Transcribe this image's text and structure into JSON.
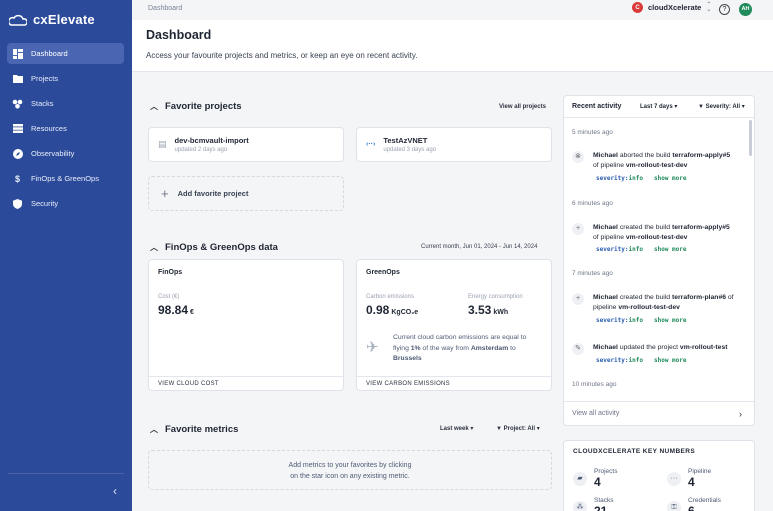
{
  "app": {
    "name": "cxElevate"
  },
  "sidebar": {
    "items": [
      {
        "label": "Dashboard",
        "icon": "dashboard-icon",
        "active": true
      },
      {
        "label": "Projects",
        "icon": "folder-icon"
      },
      {
        "label": "Stacks",
        "icon": "stacks-icon"
      },
      {
        "label": "Resources",
        "icon": "server-icon"
      },
      {
        "label": "Observability",
        "icon": "compass-icon"
      },
      {
        "label": "FinOps & GreenOps",
        "icon": "dollar-icon"
      },
      {
        "label": "Security",
        "icon": "shield-icon"
      }
    ],
    "collapse_icon": "chevron-left-icon"
  },
  "topbar": {
    "breadcrumb": "Dashboard",
    "org_initial": "C",
    "org_name": "cloudXcelerate",
    "avatar": "AH"
  },
  "header": {
    "title": "Dashboard",
    "subtitle": "Access your favourite projects and metrics, or keep an eye on recent activity."
  },
  "favorites": {
    "title": "Favorite projects",
    "view_all": "View all projects",
    "projects": [
      {
        "name": "dev-bcmvault-import",
        "updated": "updated 2 days ago",
        "icon": "page-icon"
      },
      {
        "name": "TestAzVNET",
        "updated": "updated 3 days ago",
        "icon": "vnet-icon"
      }
    ],
    "add_label": "Add favorite project"
  },
  "finops": {
    "title": "FinOps & GreenOps data",
    "range": "Current month, Jun 01, 2024 - Jun 14, 2024",
    "finops_card": {
      "title": "FinOps",
      "cost_label": "Cost (€)",
      "cost_value": "98.84",
      "cost_unit": "€",
      "footer": "VIEW CLOUD COST"
    },
    "greenops_card": {
      "title": "GreenOps",
      "carbon_label": "Carbon emissions",
      "carbon_value": "0.98",
      "carbon_unit": "KgCO₂e",
      "energy_label": "Energy consumption",
      "energy_value": "3.53",
      "energy_unit": "kWh",
      "note_1": "Current cloud carbon emissions are equal to",
      "note_2a": "flying ",
      "note_pct": "1%",
      "note_2b": " of the way from ",
      "note_from": "Amsterdam",
      "note_2c": " to",
      "note_to": "Brussels",
      "footer": "VIEW CARBON EMISSIONS"
    }
  },
  "metrics": {
    "title": "Favorite metrics",
    "range_filter": "Last week",
    "project_filter": "Project: All",
    "empty_1": "Add metrics to your favorites by clicking",
    "empty_2": "on the star icon on any existing metric."
  },
  "activity": {
    "title": "Recent activity",
    "range": "Last 7 days",
    "severity": "Severity: All",
    "groups": [
      {
        "time": "5 minutes ago"
      },
      {
        "time": "6 minutes ago"
      },
      {
        "time": "7 minutes ago"
      },
      {
        "time": "10 minutes ago"
      }
    ],
    "entries": [
      {
        "user": "Michael",
        "action": " aborted the build ",
        "target": "terraform-apply#5",
        "mid": " of pipeline ",
        "pipeline": "vm-rollout-test-dev",
        "sev_key": "severity:",
        "sev_val": "info",
        "more": "show more"
      },
      {
        "user": "Michael",
        "action": " created the build ",
        "target": "terraform-apply#5",
        "mid": " of pipeline ",
        "pipeline": "vm-rollout-test-dev",
        "sev_key": "severity:",
        "sev_val": "info",
        "more": "show more"
      },
      {
        "user": "Michael",
        "action": " created the build ",
        "target": "terraform-plan#6",
        "mid": " of pipeline ",
        "pipeline": "vm-rollout-test-dev",
        "sev_key": "severity:",
        "sev_val": "info",
        "more": "show more"
      },
      {
        "user": "Michael",
        "action": " updated the project ",
        "target": "vm-rollout-test",
        "sev_key": "severity:",
        "sev_val": "info",
        "more": "show more"
      }
    ],
    "view_all": "View all activity"
  },
  "key_numbers": {
    "title": "CLOUDXCELERATE KEY NUMBERS",
    "items": [
      {
        "label": "Projects",
        "value": "4",
        "icon": "folder-icon"
      },
      {
        "label": "Pipeline",
        "value": "4",
        "icon": "pipeline-icon"
      },
      {
        "label": "Stacks",
        "value": "21",
        "icon": "stacks-icon"
      },
      {
        "label": "Credentials",
        "value": "6",
        "icon": "key-icon"
      }
    ]
  }
}
